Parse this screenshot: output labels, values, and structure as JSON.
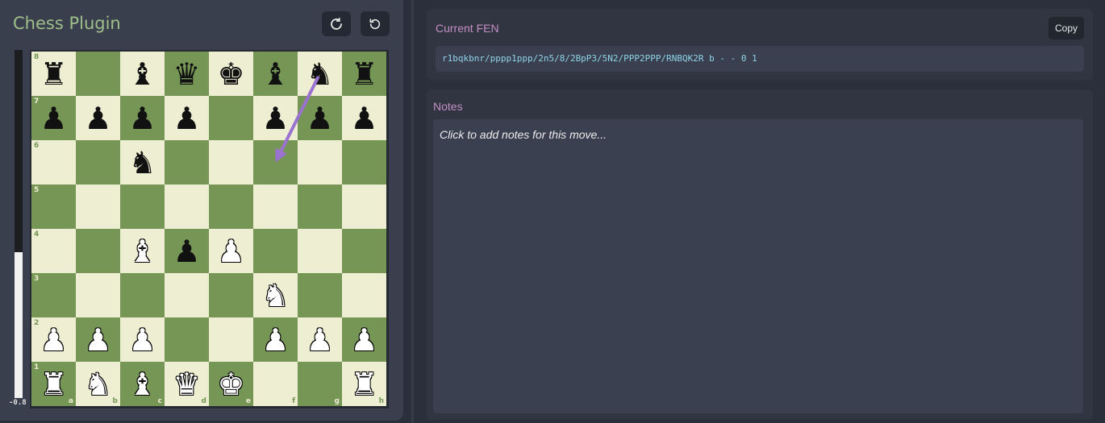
{
  "app": {
    "title": "Chess Plugin"
  },
  "toolbar": {
    "flip_icon": "rotate-cw-icon",
    "reset_icon": "reset-icon"
  },
  "eval": {
    "label": "-0.8",
    "white_fraction": 0.42
  },
  "board": {
    "ranks": [
      "8",
      "7",
      "6",
      "5",
      "4",
      "3",
      "2",
      "1"
    ],
    "files": [
      "a",
      "b",
      "c",
      "d",
      "e",
      "f",
      "g",
      "h"
    ],
    "light_color": "#eeeed2",
    "dark_color": "#769656",
    "fen_position": "r1bqkbnr/pppp1ppp/2n5/8/2BpP3/5N2/PPP2PPP/RNBQK2R",
    "arrow": {
      "from": "g8",
      "to": "f6",
      "color": "#9b72cf"
    }
  },
  "fen": {
    "title": "Current FEN",
    "value": "r1bqkbnr/pppp1ppp/2n5/8/2BpP3/5N2/PPP2PPP/RNBQK2R b - - 0 1",
    "copy_label": "Copy"
  },
  "notes": {
    "title": "Notes",
    "placeholder": "Click to add notes for this move..."
  }
}
